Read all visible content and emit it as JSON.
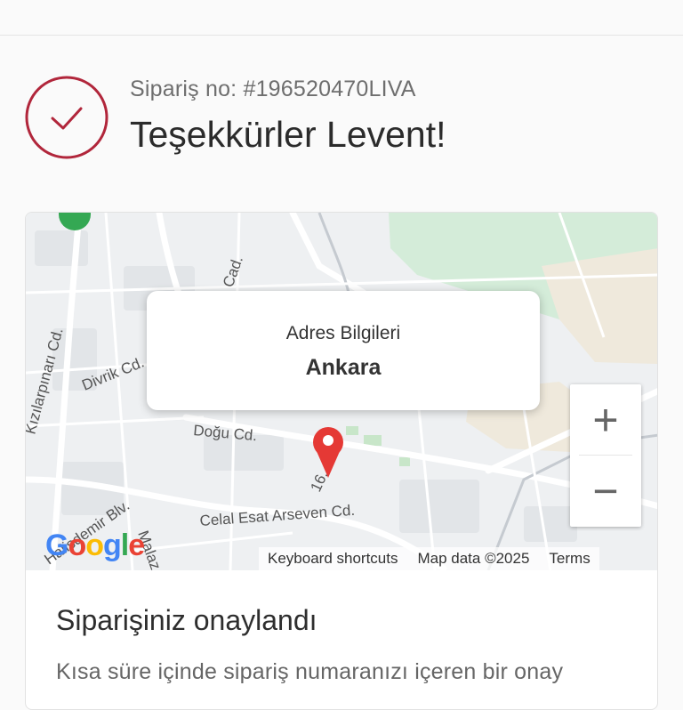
{
  "order": {
    "number_text": "Sipariş no: #196520470LIVA",
    "thanks_text": "Teşekkürler Levent!"
  },
  "map": {
    "info_window": {
      "label": "Adres Bilgileri",
      "city": "Ankara"
    },
    "streets": [
      "Kızılarpınarı Cd.",
      "Divrik Cd.",
      "Doğu Cd.",
      "Celal Esat Arseven Cd.",
      "Halisdemir Blv.",
      "Malaz",
      "16. Cd.",
      "Cad."
    ],
    "zoom_in": "+",
    "zoom_out": "−",
    "footer": {
      "shortcuts": "Keyboard shortcuts",
      "map_data": "Map data ©2025",
      "terms": "Terms"
    },
    "logo": "Google"
  },
  "confirmation": {
    "title": "Siparişiniz onaylandı",
    "text": "Kısa süre içinde sipariş numaranızı içeren bir onay"
  },
  "colors": {
    "accent": "#b1263b",
    "pin": "#e53935"
  }
}
